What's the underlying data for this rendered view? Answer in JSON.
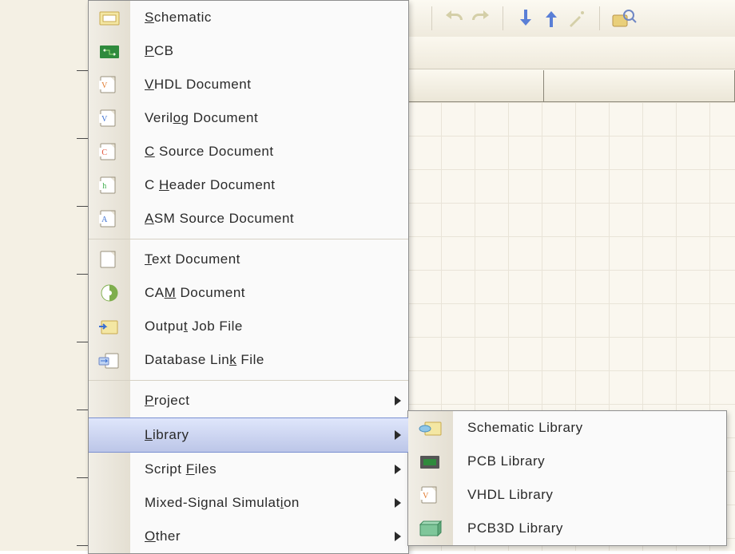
{
  "menu": {
    "items": [
      {
        "icon": "schematic-icon",
        "label": "Schematic",
        "mnem": 0
      },
      {
        "icon": "pcb-icon",
        "label": "PCB",
        "mnem": 0
      },
      {
        "icon": "vhdl-icon",
        "label": "VHDL Document",
        "mnem": 0
      },
      {
        "icon": "verilog-icon",
        "label": "Verilog Document",
        "mnem": 5
      },
      {
        "icon": "c-src-icon",
        "label": "C Source Document",
        "mnem": 0
      },
      {
        "icon": "c-hdr-icon",
        "label": "C Header Document",
        "mnem": 2
      },
      {
        "icon": "asm-icon",
        "label": "ASM Source Document",
        "mnem": 0
      },
      {
        "icon": "text-icon",
        "label": "Text Document",
        "mnem": 0,
        "sep": true
      },
      {
        "icon": "cam-icon",
        "label": "CAM Document",
        "mnem": 2
      },
      {
        "icon": "outjob-icon",
        "label": "Output Job File",
        "mnem": 5
      },
      {
        "icon": "dblink-icon",
        "label": "Database Link File",
        "mnem": 12
      },
      {
        "icon": "",
        "label": "Project",
        "mnem": 0,
        "sub": true,
        "sep": true
      },
      {
        "icon": "",
        "label": "Library",
        "mnem": 0,
        "sub": true,
        "hot": true
      },
      {
        "icon": "",
        "label": "Script Files",
        "mnem": 7,
        "sub": true
      },
      {
        "icon": "",
        "label": "Mixed-Signal Simulation",
        "mnem": 20,
        "sub": true
      },
      {
        "icon": "",
        "label": "Other",
        "mnem": 0,
        "sub": true
      }
    ]
  },
  "submenu": {
    "items": [
      {
        "icon": "schlib-icon",
        "label": "Schematic Library",
        "mnem": 10
      },
      {
        "icon": "pcblib-icon",
        "label": "PCB Library",
        "mnem": 10
      },
      {
        "icon": "vhdllib-icon",
        "label": "VHDL Library",
        "mnem": 1
      },
      {
        "icon": "pcb3d-icon",
        "label": "PCB3D Library",
        "mnem": 4
      }
    ]
  }
}
